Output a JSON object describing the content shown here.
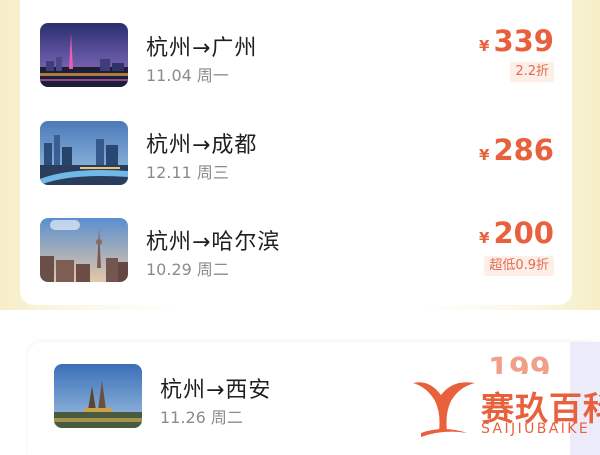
{
  "currency": "¥",
  "flights": [
    {
      "route": "杭州→广州",
      "date": "11.04 周一",
      "price": "339",
      "badge": "2.2折"
    },
    {
      "route": "杭州→成都",
      "date": "12.11 周三",
      "price": "286",
      "badge": ""
    },
    {
      "route": "杭州→哈尔滨",
      "date": "10.29 周二",
      "price": "200",
      "badge": "超低0.9折"
    },
    {
      "route": "杭州→西安",
      "date": "11.26 周二",
      "price": "199",
      "badge": ""
    }
  ],
  "watermark": {
    "title": "赛玖百科",
    "subtitle": "SAIJIUBAIKE",
    "icon": "whale-tail-logo"
  },
  "colors": {
    "accent": "#e9603d",
    "badge_bg": "#fdeee8"
  }
}
